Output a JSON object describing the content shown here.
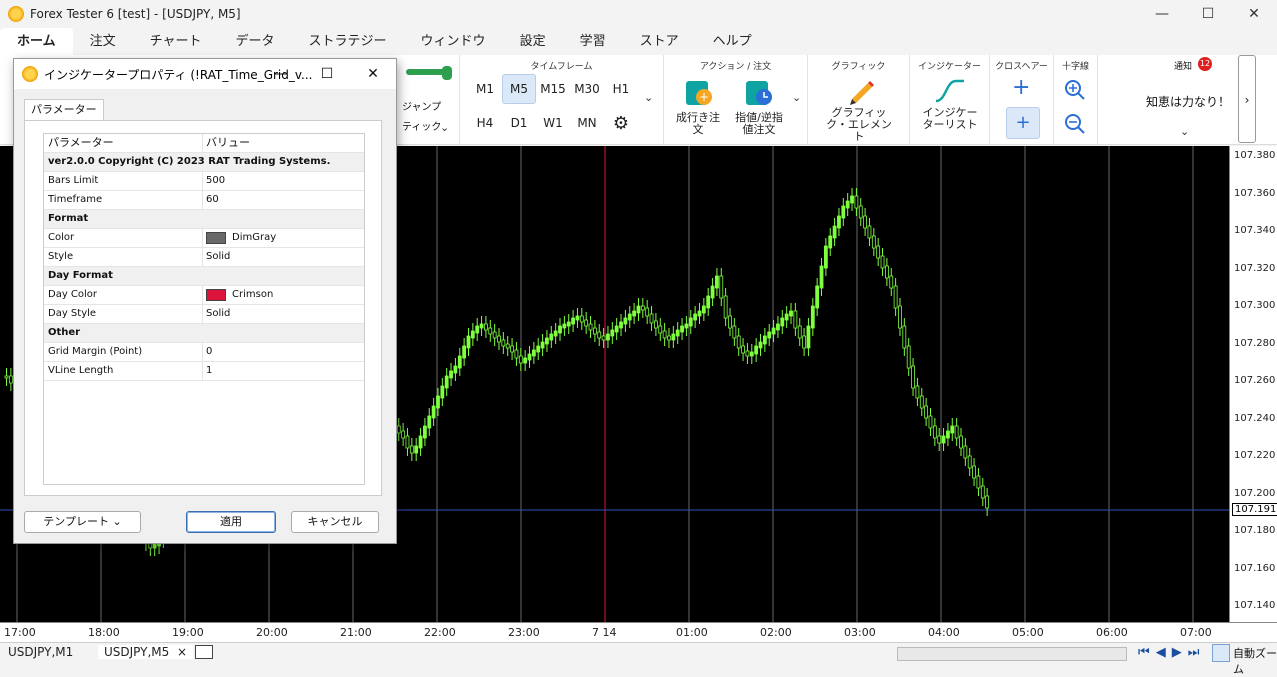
{
  "window": {
    "title": "Forex Tester 6  [test] - [USDJPY, M5]",
    "minimize": "—",
    "maximize": "☐",
    "close": "✕"
  },
  "menu": [
    "ホーム",
    "注文",
    "チャート",
    "データ",
    "ストラテジー",
    "ウィンドウ",
    "設定",
    "学習",
    "ストア",
    "ヘルプ"
  ],
  "ribbon": {
    "timeframe_label": "タイムフレーム",
    "timeframes_row1": [
      "M1",
      "M5",
      "M15",
      "M30",
      "H1"
    ],
    "timeframes_row2": [
      "H4",
      "D1",
      "W1",
      "MN"
    ],
    "selected_timeframe": "M5",
    "jump_label": "ジャンプ",
    "tick_label": "ティック",
    "action_label": "アクション / 注文",
    "market_order": "成行き注文",
    "limit_order": "指値/逆指値注文",
    "graphic_label": "グラフィック",
    "graphic_elements": "グラフィック・エレメント",
    "indicator_label": "インジケーター",
    "indicator_list": "インジケーターリスト",
    "crosshair_label": "クロスヘアー",
    "cross_label": "十字線",
    "notify_label": "通知",
    "notify_count": "12",
    "notify_text": "知恵は力なり！"
  },
  "chart": {
    "symbol_bg": "#000000",
    "candle_color": "#7fff40",
    "vline_day_color": "#DC143C",
    "vline_grid_color": "#696969",
    "current_price": "107.191",
    "price_labels": [
      "107.380",
      "107.360",
      "107.340",
      "107.320",
      "107.300",
      "107.280",
      "107.260",
      "107.240",
      "107.220",
      "107.200",
      "107.180",
      "107.160",
      "107.140"
    ],
    "time_labels": [
      "17:00",
      "18:00",
      "19:00",
      "20:00",
      "21:00",
      "22:00",
      "23:00",
      "7 14",
      "01:00",
      "02:00",
      "03:00",
      "04:00",
      "05:00",
      "06:00",
      "07:00"
    ]
  },
  "tabs": [
    "USDJPY,M1",
    "USDJPY,M5"
  ],
  "tab_close": "×",
  "zoom_label": "自動ズーム",
  "dialog": {
    "title": "インジケータープロパティ (!RAT_Time_Grid_v...",
    "tab": "パラメーター",
    "col_param": "パラメーター",
    "col_value": "バリュー",
    "copyright": "ver2.0.0 Copyright (C) 2023 RAT Trading Systems.",
    "rows": [
      {
        "k": "Bars Limit",
        "v": "500"
      },
      {
        "k": "Timeframe",
        "v": "60"
      }
    ],
    "format_section": "Format",
    "format_rows": [
      {
        "k": "Color",
        "v": "DimGray",
        "swatch": "#696969"
      },
      {
        "k": "Style",
        "v": "Solid"
      }
    ],
    "day_section": "Day Format",
    "day_rows": [
      {
        "k": "Day Color",
        "v": "Crimson",
        "swatch": "#DC143C"
      },
      {
        "k": "Day Style",
        "v": "Solid"
      }
    ],
    "other_section": "Other",
    "other_rows": [
      {
        "k": "Grid Margin (Point)",
        "v": "0"
      },
      {
        "k": "VLine Length",
        "v": "1"
      }
    ],
    "btn_template": "テンプレート ⌄",
    "btn_apply": "適用",
    "btn_cancel": "キャンセル"
  }
}
